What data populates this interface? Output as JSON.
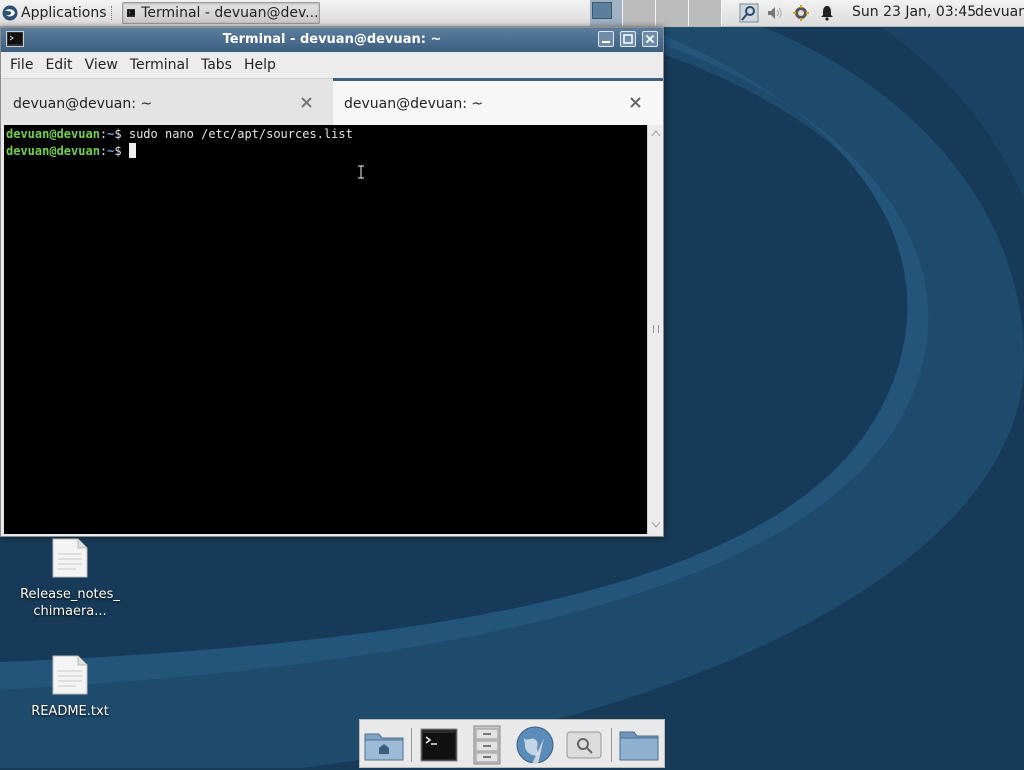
{
  "top_panel": {
    "applications_label": "Applications",
    "taskbar_item_label": "Terminal - devuan@dev...",
    "clock": "Sun 23 Jan, 03:45",
    "user": "devuan"
  },
  "window": {
    "title": "Terminal - devuan@devuan: ~",
    "menus": [
      "File",
      "Edit",
      "View",
      "Terminal",
      "Tabs",
      "Help"
    ],
    "tabs": [
      {
        "label": "devuan@devuan: ~",
        "active": false
      },
      {
        "label": "devuan@devuan: ~",
        "active": true
      }
    ]
  },
  "terminal": {
    "lines": [
      {
        "user": "devuan@devuan",
        "sep": ":",
        "path": "~",
        "symbol": "$ ",
        "command": "sudo nano /etc/apt/sources.list"
      },
      {
        "user": "devuan@devuan",
        "sep": ":",
        "path": "~",
        "symbol": "$ ",
        "command": ""
      }
    ]
  },
  "desktop": {
    "icons": [
      {
        "label": "Release_notes_chimaera..."
      },
      {
        "label": "README.txt"
      }
    ]
  },
  "colors": {
    "desktop_bg": "#163a57",
    "titlebar": "#3d5f7f",
    "prompt_user": "#6fd24a",
    "prompt_path": "#5aa2e6"
  },
  "dock": {
    "items": [
      "home-folder-icon",
      "terminal-icon",
      "file-cabinet-icon",
      "web-browser-icon",
      "search-icon",
      "folder-icon"
    ]
  }
}
